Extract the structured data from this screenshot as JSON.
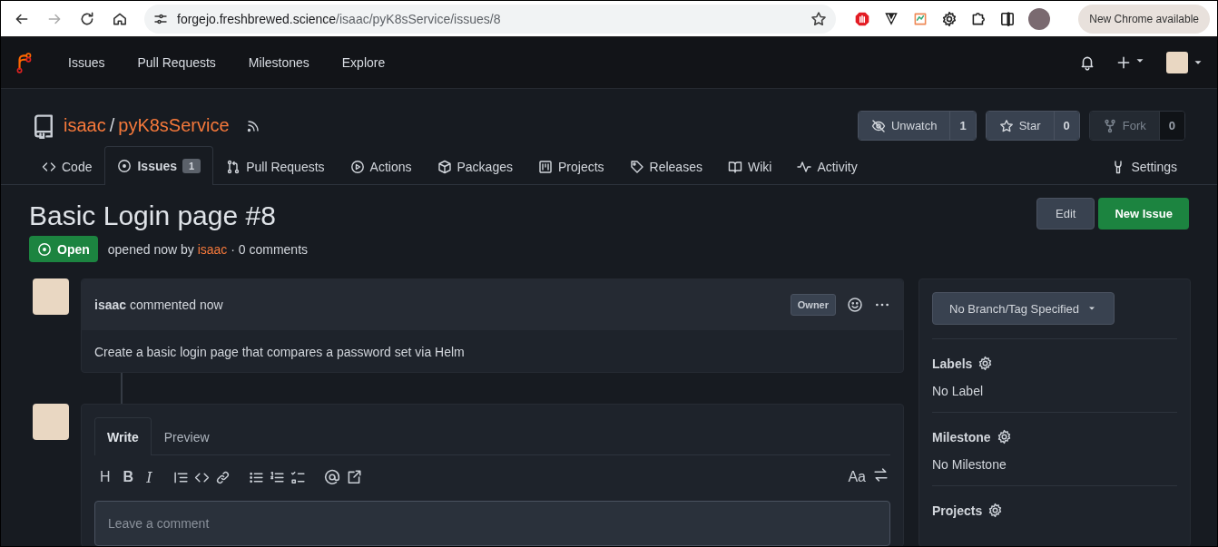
{
  "browser": {
    "url_host": "forgejo.freshbrewed.science",
    "url_path": "/isaac/pyK8sService/issues/8",
    "update_label": "New Chrome available"
  },
  "navbar": {
    "items": [
      "Issues",
      "Pull Requests",
      "Milestones",
      "Explore"
    ]
  },
  "repo": {
    "owner": "isaac",
    "separator": "/",
    "name": "pyK8sService",
    "buttons": [
      {
        "label": "Unwatch",
        "count": "1",
        "disabled": false
      },
      {
        "label": "Star",
        "count": "0",
        "disabled": false
      },
      {
        "label": "Fork",
        "count": "0",
        "disabled": true
      }
    ]
  },
  "tabs": [
    {
      "label": "Code",
      "selected": false
    },
    {
      "label": "Issues",
      "count": "1",
      "selected": true
    },
    {
      "label": "Pull Requests",
      "selected": false
    },
    {
      "label": "Actions",
      "selected": false
    },
    {
      "label": "Packages",
      "selected": false
    },
    {
      "label": "Projects",
      "selected": false
    },
    {
      "label": "Releases",
      "selected": false
    },
    {
      "label": "Wiki",
      "selected": false
    },
    {
      "label": "Activity",
      "selected": false
    }
  ],
  "settings_tab": "Settings",
  "issue": {
    "title": "Basic Login page #8",
    "state": "Open",
    "opened": "opened now by",
    "author": "isaac",
    "comments": "· 0 comments",
    "buttons": [
      "Edit",
      "New Issue"
    ]
  },
  "comment": {
    "author": "isaac",
    "action": "commented now",
    "role": "Owner",
    "body": "Create a basic login page that compares a password set via Helm"
  },
  "editor": {
    "tabs": [
      {
        "label": "Write",
        "selected": true
      },
      {
        "label": "Preview",
        "selected": false
      }
    ],
    "glyph_tools": [
      "H",
      "B",
      "I"
    ],
    "font_toggle": "Aa",
    "placeholder": "Leave a comment"
  },
  "sidebar": {
    "branch_button": "No Branch/Tag Specified",
    "sections": [
      {
        "title": "Labels",
        "value": "No Label"
      },
      {
        "title": "Milestone",
        "value": "No Milestone"
      },
      {
        "title": "Projects"
      }
    ]
  }
}
